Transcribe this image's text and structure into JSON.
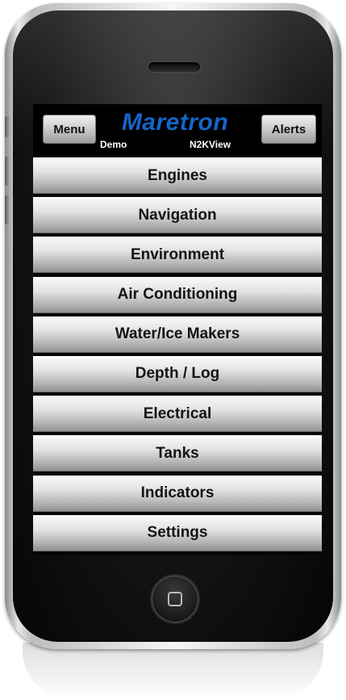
{
  "header": {
    "menu_label": "Menu",
    "alerts_label": "Alerts",
    "brand": "Maretron",
    "mode": "Demo",
    "app_name": "N2KView"
  },
  "menu": {
    "items": [
      {
        "label": "Engines"
      },
      {
        "label": "Navigation"
      },
      {
        "label": "Environment"
      },
      {
        "label": "Air Conditioning"
      },
      {
        "label": "Water/Ice Makers"
      },
      {
        "label": "Depth / Log"
      },
      {
        "label": "Electrical"
      },
      {
        "label": "Tanks"
      },
      {
        "label": "Indicators"
      },
      {
        "label": "Settings"
      }
    ]
  },
  "colors": {
    "brand": "#1565c8",
    "button_text": "#141414",
    "screen_background": "#060606"
  },
  "icons": {
    "home": "home-button-icon",
    "speaker": "speaker-grille-icon"
  }
}
